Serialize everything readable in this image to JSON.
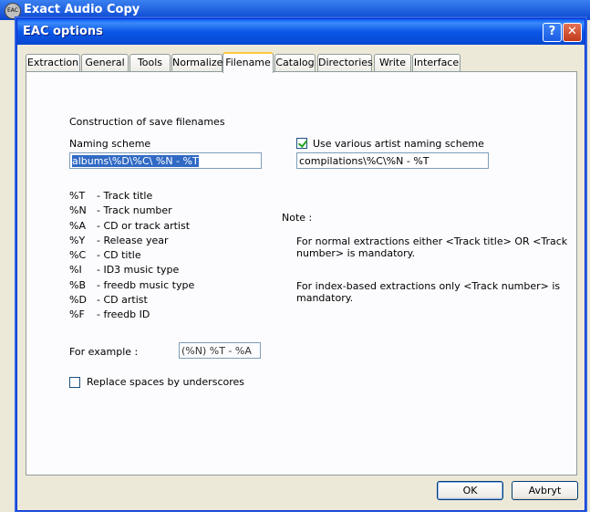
{
  "background": {
    "title": "Exact Audio Copy",
    "icon": "eac-logo-icon"
  },
  "dialog": {
    "title": "EAC options",
    "help_label": "?",
    "close_label": "✕"
  },
  "tabs": [
    "Extraction",
    "General",
    "Tools",
    "Normalize",
    "Filename",
    "Catalog",
    "Directories",
    "Write",
    "Interface"
  ],
  "active_tab": "Filename",
  "filename": {
    "section_title": "Construction of save filenames",
    "naming_scheme_label": "Naming scheme",
    "naming_scheme_value": "albums\\%D\\%C\\ %N - %T",
    "various_artist_label": "Use various artist naming scheme",
    "various_artist_checked": true,
    "various_artist_value": "compilations\\%C\\%N - %T",
    "placeholders": [
      {
        "code": "%T",
        "desc": "- Track title"
      },
      {
        "code": "%N",
        "desc": "- Track number"
      },
      {
        "code": "%A",
        "desc": "- CD or track artist"
      },
      {
        "code": "%Y",
        "desc": "- Release year"
      },
      {
        "code": "%C",
        "desc": "- CD title"
      },
      {
        "code": "%I",
        "desc": "- ID3 music type"
      },
      {
        "code": "%B",
        "desc": "- freedb music type"
      },
      {
        "code": "%D",
        "desc": "- CD artist"
      },
      {
        "code": "%F",
        "desc": "- freedb ID"
      }
    ],
    "note_label": "Note :",
    "note_line1a": "For normal extractions either <Track title>  OR  <Track",
    "note_line1b": "number> is mandatory.",
    "note_line2a": "For index-based extractions only <Track number> is",
    "note_line2b": "mandatory.",
    "example_label": "For example :",
    "example_value": "(%N) %T - %A",
    "replace_spaces_label": "Replace spaces by underscores",
    "replace_spaces_checked": false
  },
  "buttons": {
    "ok": "OK",
    "cancel": "Avbryt"
  }
}
